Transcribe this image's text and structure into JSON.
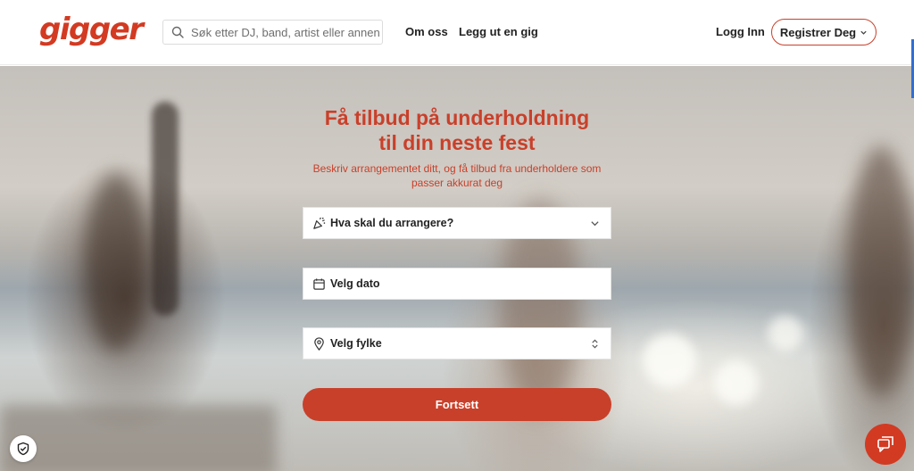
{
  "header": {
    "logo_text": "gigger",
    "search_placeholder": "Søk etter DJ, band, artist eller annen u",
    "nav": {
      "about": "Om oss",
      "post_gig": "Legg ut en gig",
      "login": "Logg Inn",
      "register": "Registrer Deg"
    }
  },
  "hero": {
    "title_line1": "Få tilbud på underholdning",
    "title_line2": "til din neste fest",
    "subtitle_line1": "Beskriv arrangementet ditt, og få tilbud fra underholdere som",
    "subtitle_line2": "passer akkurat deg",
    "form": {
      "event_label": "Hva skal du arrangere?",
      "date_label": "Velg dato",
      "county_label": "Velg fylke",
      "continue_label": "Fortsett"
    }
  },
  "colors": {
    "brand": "#d33a22",
    "button": "#c9402a"
  },
  "icons": {
    "search": "search-icon",
    "party": "party-popper-icon",
    "calendar": "calendar-icon",
    "location": "map-pin-icon",
    "chevron": "chevron-down-icon",
    "select": "select-updown-icon",
    "shield": "shield-check-icon",
    "chat": "chat-bubble-icon"
  }
}
